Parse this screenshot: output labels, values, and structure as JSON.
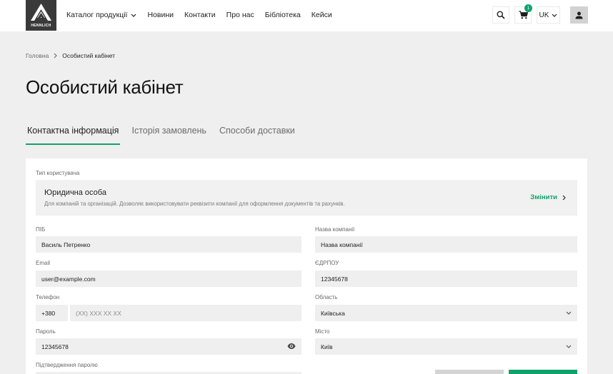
{
  "header": {
    "logo_text": "HENNLICH",
    "nav": [
      {
        "label": "Каталог продукції",
        "has_dropdown": true
      },
      {
        "label": "Новини"
      },
      {
        "label": "Контакти"
      },
      {
        "label": "Про нас"
      },
      {
        "label": "Бібліотека"
      },
      {
        "label": "Кейси"
      }
    ],
    "cart_count": "1",
    "language": "UK",
    "icons": {
      "search": "search-icon",
      "cart": "cart-icon",
      "user": "user-icon"
    }
  },
  "breadcrumb": {
    "home": "Головна",
    "current": "Особистий кабінет"
  },
  "page_title": "Особистий кабінет",
  "tabs": [
    {
      "label": "Контактна інформація",
      "active": true
    },
    {
      "label": "Історія замовлень",
      "active": false
    },
    {
      "label": "Способи доставки",
      "active": false
    }
  ],
  "user_type": {
    "label": "Тип користувача",
    "name": "Юридична особа",
    "description": "Для компаній та організацій. Дозволяє використовувати реквізити компанії для оформлення документів та рахунків.",
    "change_label": "Змінити"
  },
  "form": {
    "pib": {
      "label": "ПІБ",
      "value": "Василь Петренко"
    },
    "email": {
      "label": "Email",
      "value": "user@example.com"
    },
    "phone": {
      "label": "Телефон",
      "code": "+380",
      "placeholder": "(XX) XXX XX XX"
    },
    "password": {
      "label": "Пароль",
      "value": "12345678"
    },
    "password_confirm": {
      "label": "Підтвердження паролю"
    },
    "company": {
      "label": "Назва компанії",
      "value": "Назва компанії"
    },
    "edrpou": {
      "label": "ЄДРПОУ",
      "value": "12345678"
    },
    "region": {
      "label": "Область",
      "value": "Київська"
    },
    "city": {
      "label": "Місто",
      "value": "Київ"
    }
  },
  "colors": {
    "accent": "#0fa36b",
    "background": "#efefef",
    "logo_bg": "#3a3a3a"
  }
}
